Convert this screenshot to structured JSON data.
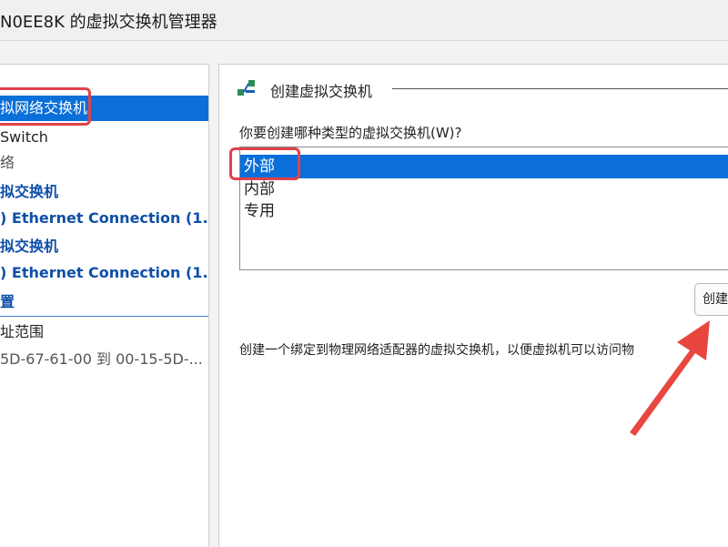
{
  "window": {
    "title": "N0EE8K 的虚拟交换机管理器"
  },
  "sidebar": {
    "items": [
      {
        "label": "拟网络交换机"
      },
      {
        "label": "Switch"
      },
      {
        "label": "络"
      },
      {
        "label": "拟交换机"
      },
      {
        "label": ") Ethernet Connection (1..."
      },
      {
        "label": "拟交换机"
      },
      {
        "label": ") Ethernet Connection (1..."
      },
      {
        "label": "置"
      },
      {
        "label": "址范围"
      },
      {
        "label": "5D-67-61-00 到 00-15-5D-..."
      }
    ]
  },
  "main": {
    "group_title": "创建虚拟交换机",
    "question": "你要创建哪种类型的虚拟交换机(W)?",
    "switch_types": [
      "外部",
      "内部",
      "专用"
    ],
    "create_button_label": "创建",
    "description": "创建一个绑定到物理网络适配器的虚拟交换机，以便虚拟机可以访问物"
  },
  "colors": {
    "selection_blue": "#0a6fd8",
    "highlight_red": "#e0414a",
    "link_blue": "#0f4fa8"
  }
}
